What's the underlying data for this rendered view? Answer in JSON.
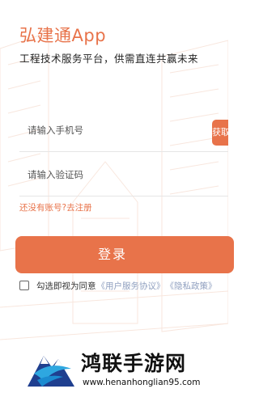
{
  "header": {
    "app_title": "弘建通App",
    "subtitle": "工程技术服务平台，供需直连共赢未来"
  },
  "form": {
    "phone_placeholder": "请输入手机号",
    "code_placeholder": "请输入验证码",
    "send_code_label": "获取验证码",
    "register_link": "还没有账号?去注册",
    "login_label": "登录"
  },
  "agreement": {
    "prefix": "勾选即视为同意",
    "user_agreement": "《用户服务协议》",
    "privacy_policy": "《隐私政策》",
    "checked": false
  },
  "watermark": {
    "title": "鸿联手游网",
    "url": "www.henanhonglian95.com"
  },
  "colors": {
    "accent": "#e8734a",
    "link": "#8f9fbf"
  }
}
